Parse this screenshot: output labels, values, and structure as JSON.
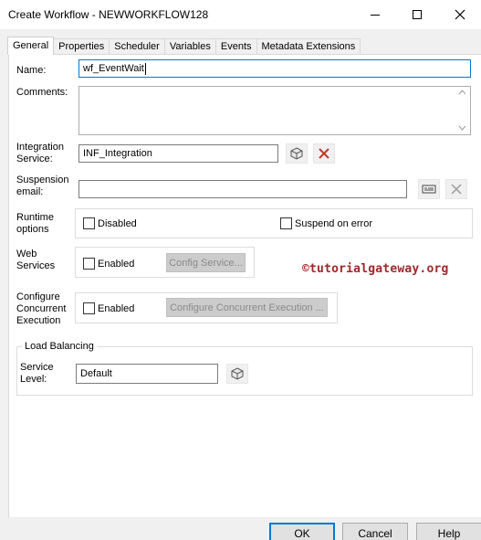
{
  "window": {
    "title": "Create Workflow - NEWWORKFLOW128"
  },
  "tabs": [
    {
      "label": "General",
      "active": true
    },
    {
      "label": "Properties"
    },
    {
      "label": "Scheduler"
    },
    {
      "label": "Variables"
    },
    {
      "label": "Events"
    },
    {
      "label": "Metadata Extensions"
    }
  ],
  "form": {
    "name_label": "Name:",
    "name_value": "wf_EventWait",
    "comments_label": "Comments:",
    "comments_value": "",
    "integration_label_line1": "Integration",
    "integration_label_line2": "Service:",
    "integration_value": "INF_Integration",
    "suspension_label_line1": "Suspension",
    "suspension_label_line2": "email:",
    "suspension_value": "",
    "runtime_label_line1": "Runtime",
    "runtime_label_line2": "options",
    "disabled_label": "Disabled",
    "disabled_checked": false,
    "suspend_label": "Suspend on error",
    "suspend_checked": false,
    "web_label_line1": "Web",
    "web_label_line2": "Services",
    "web_enabled_label": "Enabled",
    "web_enabled_checked": false,
    "config_service_label": "Config Service...",
    "concurrent_label_line1": "Configure",
    "concurrent_label_line2": "Concurrent",
    "concurrent_label_line3": "Execution",
    "concurrent_enabled_label": "Enabled",
    "concurrent_enabled_checked": false,
    "configure_concurrent_label": "Configure Concurrent Execution ...",
    "load_balancing_legend": "Load Balancing",
    "service_level_label_line1": "Service",
    "service_level_label_line2": "Level:",
    "service_level_value": "Default"
  },
  "watermark": "©tutorialgateway.org",
  "footer": {
    "ok_label": "OK",
    "cancel_label": "Cancel",
    "help_label": "Help"
  },
  "colors": {
    "accent": "#0078d7",
    "watermark": "#a0282b",
    "delete_icon": "#c0392b"
  },
  "icons": [
    "minimize-icon",
    "maximize-icon",
    "close-icon",
    "browse-service-icon",
    "delete-icon",
    "email-icon",
    "clear-icon",
    "browse-service-level-icon"
  ]
}
